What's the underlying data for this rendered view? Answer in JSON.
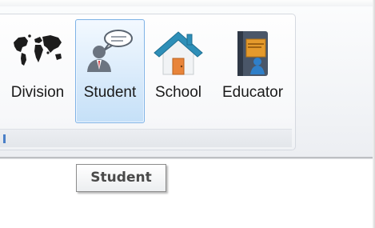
{
  "ribbon": {
    "buttons": [
      {
        "label": "Division",
        "icon": "world-map-icon"
      },
      {
        "label": "Student",
        "icon": "student-icon",
        "state": "hover"
      },
      {
        "label": "School",
        "icon": "school-house-icon"
      },
      {
        "label": "Educator",
        "icon": "book-icon"
      }
    ]
  },
  "tooltip": {
    "text": "Student"
  },
  "colors": {
    "hover_border": "#7fb3e6",
    "hover_fill": "#dcecfb",
    "house_roof": "#2e8fb8",
    "house_door": "#e8843a",
    "book_cover": "#4a5668",
    "book_label": "#e59a2c"
  }
}
